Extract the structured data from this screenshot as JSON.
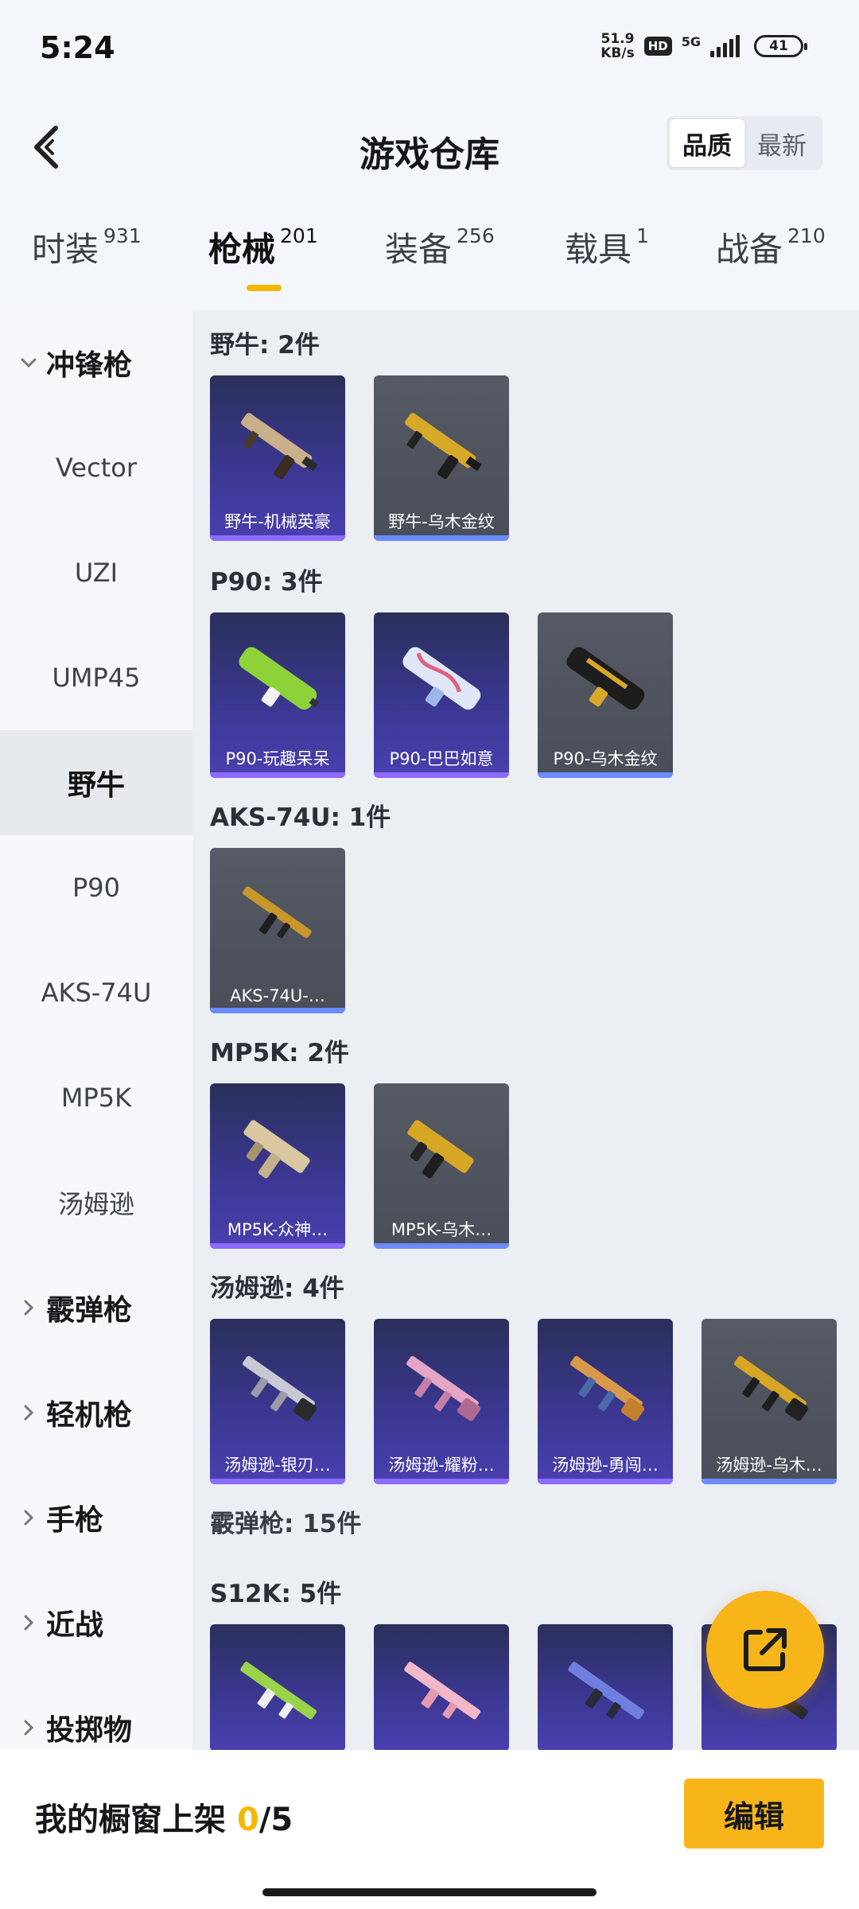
{
  "status_bar": {
    "time": "5:24",
    "speed_value": "51.9",
    "speed_unit": "KB/s",
    "hd": "HD",
    "network": "5G",
    "battery": "41"
  },
  "header": {
    "title": "游戏仓库",
    "sort_quality": "品质",
    "sort_latest": "最新"
  },
  "tabs": [
    {
      "label": "时装",
      "count": "931"
    },
    {
      "label": "枪械",
      "count": "201"
    },
    {
      "label": "装备",
      "count": "256"
    },
    {
      "label": "载具",
      "count": "1"
    },
    {
      "label": "战备",
      "count": "210"
    }
  ],
  "sidebar": {
    "groups": [
      {
        "label": "冲锋枪"
      },
      {
        "label": "霰弹枪"
      },
      {
        "label": "轻机枪"
      },
      {
        "label": "手枪"
      },
      {
        "label": "近战"
      },
      {
        "label": "投掷物"
      }
    ],
    "items": [
      {
        "label": "Vector"
      },
      {
        "label": "UZI"
      },
      {
        "label": "UMP45"
      },
      {
        "label": "野牛"
      },
      {
        "label": "P90"
      },
      {
        "label": "AKS-74U"
      },
      {
        "label": "MP5K"
      },
      {
        "label": "汤姆逊"
      }
    ]
  },
  "sections": [
    {
      "title": "野牛: 2件",
      "cards": [
        {
          "label": "野牛-机械英豪"
        },
        {
          "label": "野牛-乌木金纹"
        }
      ]
    },
    {
      "title": "P90: 3件",
      "cards": [
        {
          "label": "P90-玩趣呆呆"
        },
        {
          "label": "P90-巴巴如意"
        },
        {
          "label": "P90-乌木金纹"
        }
      ]
    },
    {
      "title": "AKS-74U: 1件",
      "cards": [
        {
          "label": "AKS-74U-…"
        }
      ]
    },
    {
      "title": "MP5K: 2件",
      "cards": [
        {
          "label": "MP5K-众神…"
        },
        {
          "label": "MP5K-乌木…"
        }
      ]
    },
    {
      "title": "汤姆逊: 4件",
      "cards": [
        {
          "label": "汤姆逊-银刃…"
        },
        {
          "label": "汤姆逊-耀粉…"
        },
        {
          "label": "汤姆逊-勇闯…"
        },
        {
          "label": "汤姆逊-乌木…"
        }
      ]
    },
    {
      "title": "霰弹枪: 15件",
      "cards": []
    },
    {
      "title": "S12K: 5件",
      "cards": []
    }
  ],
  "bottom_bar": {
    "showcase_label": "我的橱窗上架",
    "showcase_current": "0",
    "showcase_total": "/5",
    "edit_label": "编辑"
  },
  "colors": {
    "accent": "#f5b800",
    "card_purple": "#3b3790",
    "card_grey": "#4f535c"
  },
  "icons": {
    "back": "back-chevron-icon",
    "share": "share-external-icon",
    "expand": "chevron-down-icon",
    "collapse": "chevron-right-icon"
  }
}
